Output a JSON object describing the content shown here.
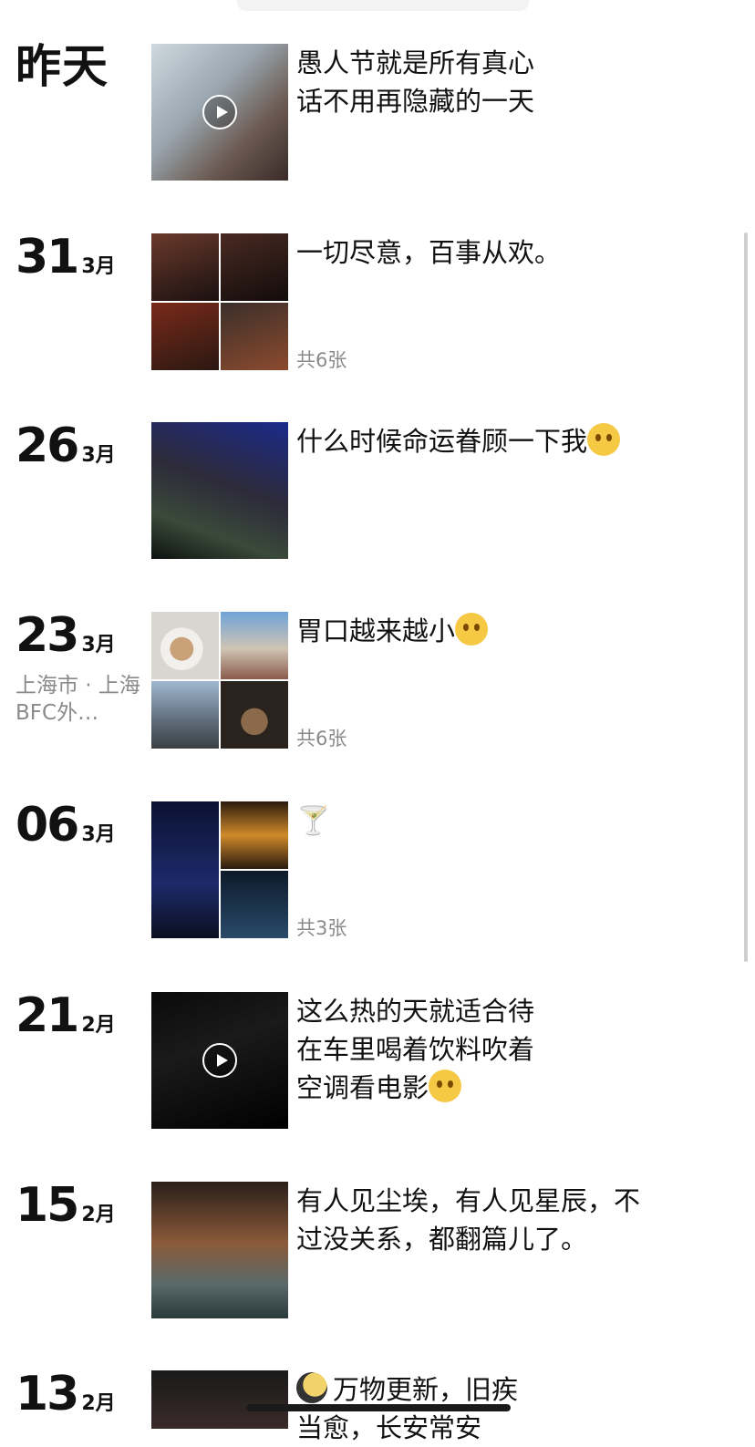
{
  "colors": {
    "text": "#111111",
    "secondary": "#8a8a8a",
    "background": "#ffffff"
  },
  "posts": [
    {
      "day": "",
      "month": "",
      "label": "昨天",
      "caption": "愚人节就是所有真心\n话不用再隐藏的一天",
      "media": "video",
      "count": ""
    },
    {
      "day": "31",
      "month": "3月",
      "label": "",
      "caption": "一切尽意，百事从欢。",
      "media": "grid",
      "count": "共6张"
    },
    {
      "day": "26",
      "month": "3月",
      "label": "",
      "caption": "什么时候命运眷顾一下我",
      "emoji": "grimace-emoji",
      "media": "single",
      "count": ""
    },
    {
      "day": "23",
      "month": "3月",
      "label": "",
      "location": "上海市 · 上海BFC外…",
      "caption": "胃口越来越小",
      "emoji": "crying-emoji",
      "media": "grid",
      "count": "共6张"
    },
    {
      "day": "06",
      "month": "3月",
      "label": "",
      "caption": "",
      "emoji": "cocktail-emoji",
      "media": "grid3",
      "count": "共3张"
    },
    {
      "day": "21",
      "month": "2月",
      "label": "",
      "caption": "这么热的天就适合待\n在车里喝着饮料吹着\n空调看电影",
      "emoji": "crying-emoji",
      "media": "video",
      "count": ""
    },
    {
      "day": "15",
      "month": "2月",
      "label": "",
      "caption": "有人见尘埃，有人见星辰，不\n过没关系，都翻篇儿了。",
      "media": "single",
      "count": ""
    },
    {
      "day": "13",
      "month": "2月",
      "label": "",
      "caption": "万物更新，旧疾\n当愈，长安常安",
      "emoji": "moon-emoji",
      "media": "single",
      "count": ""
    }
  ]
}
